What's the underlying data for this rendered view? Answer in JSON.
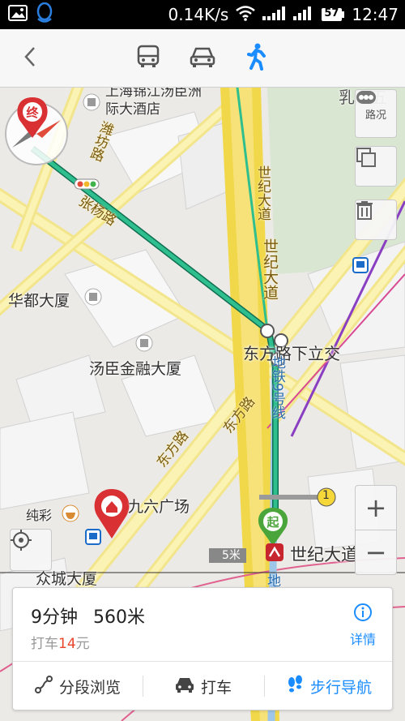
{
  "status_bar": {
    "speed": "0.14K/s",
    "battery": "57",
    "time": "12:47",
    "icons": [
      "image-icon",
      "qq-icon",
      "wifi-icon",
      "signal-icon",
      "signal-icon",
      "battery-icon"
    ]
  },
  "toolbar": {
    "back_icon": "chevron-left-icon",
    "modes": [
      "bus-icon",
      "car-icon",
      "walk-icon"
    ],
    "active_mode": "walk",
    "accent": "#1a8cff"
  },
  "map": {
    "labels": {
      "hotel": "上海锦江汤臣洲际大酒店",
      "huadu": "华都大厦",
      "tangchen": "汤臣金融大厦",
      "dongfang_junction": "东方路下立交",
      "jiuliu": "九六广场",
      "chuncai": "纯彩",
      "zhongcheng": "众城大厦",
      "shiji_station": "世纪大道",
      "rushan": "乳山五",
      "scale": "5米",
      "line_badge": "1"
    },
    "roads": {
      "weifang": "潍坊路",
      "zhangyang": "张杨路",
      "shiji1": "世纪大道",
      "shiji2": "世纪大道",
      "dongfang1": "东方路",
      "dongfang2": "东方路",
      "metro9": "地铁9号线",
      "metro_di": "地"
    },
    "markers": {
      "end": "终",
      "start": "起"
    },
    "controls": {
      "traffic": "路况",
      "zoom_in": "+",
      "zoom_out": "−"
    }
  },
  "route_card": {
    "duration": "9分钟",
    "distance": "560米",
    "taxi_prefix": "打车",
    "taxi_price": "14",
    "taxi_unit": "元",
    "details": "详情",
    "actions": {
      "segment": "分段浏览",
      "taxi": "打车",
      "walk_nav": "步行导航"
    }
  },
  "colors": {
    "route": "#1fa378",
    "accent": "#1a8cff",
    "price": "#e8462a",
    "road": "#f7e27a"
  }
}
